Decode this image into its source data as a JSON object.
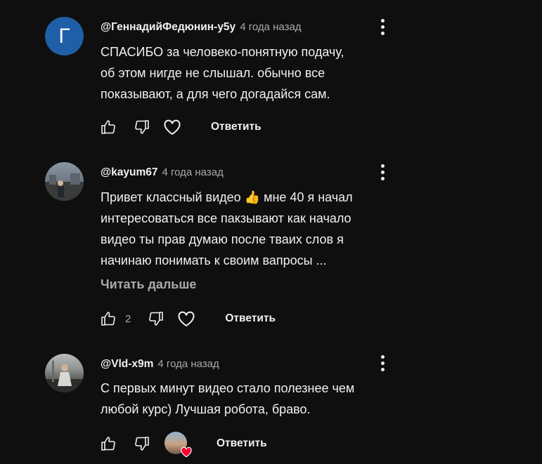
{
  "comments": [
    {
      "avatar_letter": "Г",
      "author": "@ГеннадийФедюнин-у5у",
      "time": "4 года назад",
      "lines": [
        "СПАСИБО за человеко-понятную подачу,",
        "об этом нигде не слышал. обычно все",
        "показывают, а для чего догадайся сам."
      ],
      "like_count": "",
      "reply_label": "Ответить"
    },
    {
      "author": "@kayum67",
      "time": "4 года назад",
      "lines": [
        "Привет классный видео 👍 мне 40 я начал",
        "интересоваться все пакзывают как начало",
        "видео ты прав думаю после тваих слов я",
        "начинаю понимать к своим вапросы ..."
      ],
      "read_more": "Читать дальше",
      "like_count": "2",
      "reply_label": "Ответить"
    },
    {
      "author": "@Vld-x9m",
      "time": "4 года назад",
      "lines": [
        "С первых минут видео стало полезнее чем",
        "любой курс) Лучшая робота, браво."
      ],
      "like_count": "",
      "reply_label": "Ответить",
      "creator_hearted": true
    }
  ],
  "icons": {
    "like": "thumb-up-icon",
    "dislike": "thumb-down-icon",
    "heart": "heart-outline-icon",
    "more": "more-vertical-icon",
    "creator_heart": "heart-filled-icon"
  },
  "colors": {
    "background": "#0f0f0f",
    "text": "#f1f1f1",
    "secondary_text": "#aaaaaa",
    "avatar_letter_bg": "#1f5fa8",
    "heart_red": "#ff0033"
  }
}
